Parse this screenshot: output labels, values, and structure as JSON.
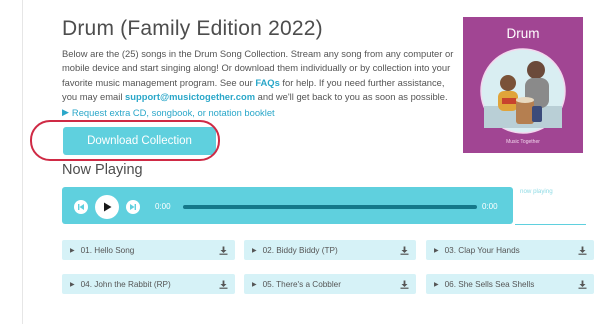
{
  "page": {
    "title": "Drum (Family Edition 2022)",
    "description": {
      "part1": "Below are the (25) songs in the Drum Song Collection. Stream any song from any computer or mobile device and start singing along! Or download them individually or by collection into your favorite music management program. See our ",
      "faq_link": "FAQs",
      "part2": " for help. If you need further assistance, you may email ",
      "email_link": "support@musictogether.com",
      "part3": " and we'll get back to you as soon as possible."
    },
    "request_link": "Request extra CD, songbook, or notation booklet",
    "download_button": "Download Collection"
  },
  "cover": {
    "title": "Drum",
    "brand": "Music Together"
  },
  "player": {
    "heading": "Now Playing",
    "elapsed": "0:00",
    "duration": "0:00",
    "now_playing_label": "now playing",
    "progress": 0
  },
  "songs": [
    {
      "label": "01. Hello Song"
    },
    {
      "label": "02. Biddy Biddy (TP)"
    },
    {
      "label": "03. Clap Your Hands"
    },
    {
      "label": "04. John the Rabbit (RP)"
    },
    {
      "label": "05. There's a Cobbler"
    },
    {
      "label": "06. She Sells Sea Shells"
    }
  ],
  "colors": {
    "accent": "#5fd0de",
    "link": "#2aa7c9",
    "song_bg": "#d6f2f7",
    "cover_bg": "#a14593",
    "highlight_ring": "#cf2a45"
  },
  "icons": {
    "prev": "skip-back-icon",
    "play": "play-icon",
    "next": "skip-forward-icon",
    "download": "download-icon",
    "song_play": "play-triangle-icon",
    "request": "play-arrow-icon"
  }
}
